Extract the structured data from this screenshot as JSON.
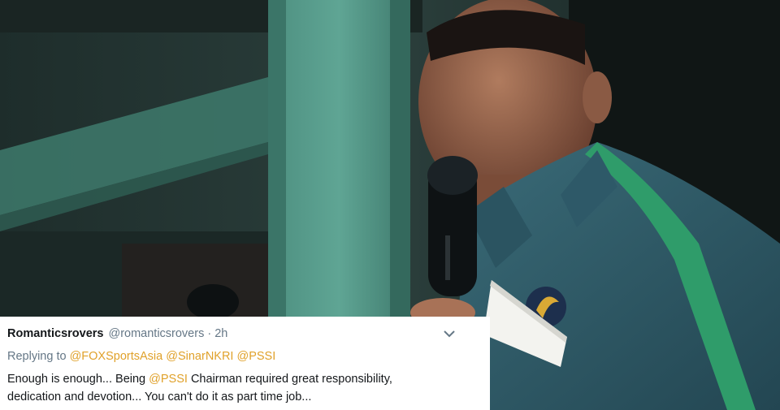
{
  "tweet": {
    "display_name": "Romanticsrovers",
    "handle_time": "@romanticsrovers · 2h",
    "replying_prefix": "Replying to",
    "mentions": [
      "@FOXSportsAsia",
      "@SinarNKRI",
      "@PSSI"
    ],
    "body_part1": "Enough is enough... Being",
    "body_mention": "@PSSI",
    "body_part2": "Chairman required great responsibility,",
    "body_line2": "dedication and devotion... You can't do it as part time job...",
    "menu_icon": "chevron-down-icon"
  },
  "colors": {
    "mention": "#e0a12a",
    "secondary_text": "#657786",
    "primary_text": "#14171a",
    "card_bg": "#ffffff"
  }
}
